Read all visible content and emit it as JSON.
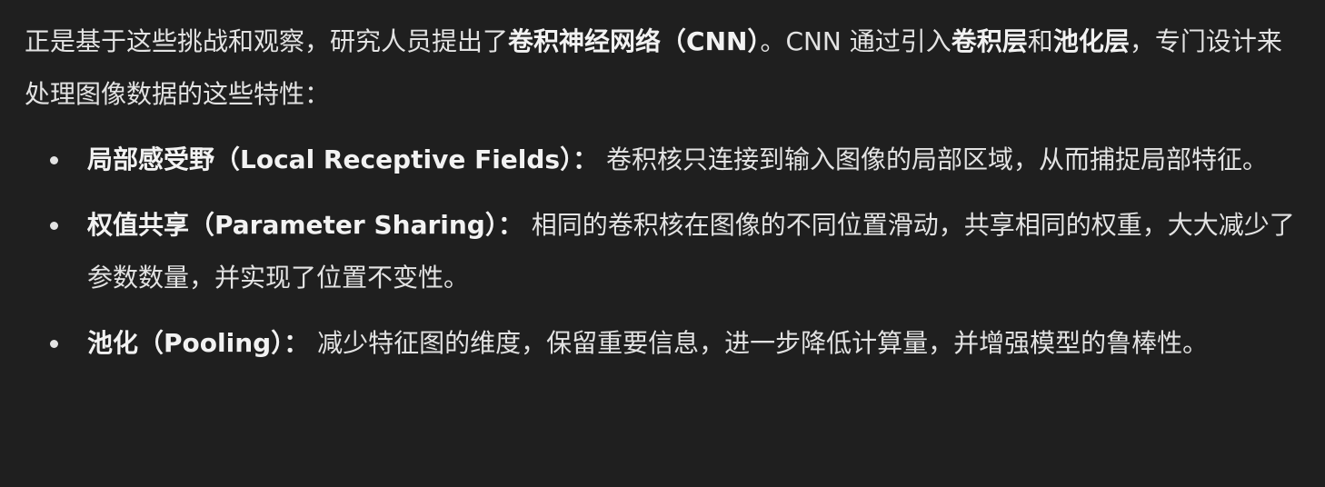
{
  "intro": {
    "part1": "正是基于这些挑战和观察，研究人员提出了",
    "term1": "卷积神经网络（CNN）",
    "part2": "。CNN 通过引入",
    "term2": "卷积层",
    "part3": "和",
    "term3": "池化层",
    "part4": "，专门设计来处理图像数据的这些特性："
  },
  "bullets": [
    {
      "term": "局部感受野（Local Receptive Fields）：",
      "text": " 卷积核只连接到输入图像的局部区域，从而捕捉局部特征。"
    },
    {
      "term": "权值共享（Parameter Sharing）：",
      "text": " 相同的卷积核在图像的不同位置滑动，共享相同的权重，大大减少了参数数量，并实现了位置不变性。"
    },
    {
      "term": "池化（Pooling）：",
      "text": " 减少特征图的维度，保留重要信息，进一步降低计算量，并增强模型的鲁棒性。"
    }
  ]
}
